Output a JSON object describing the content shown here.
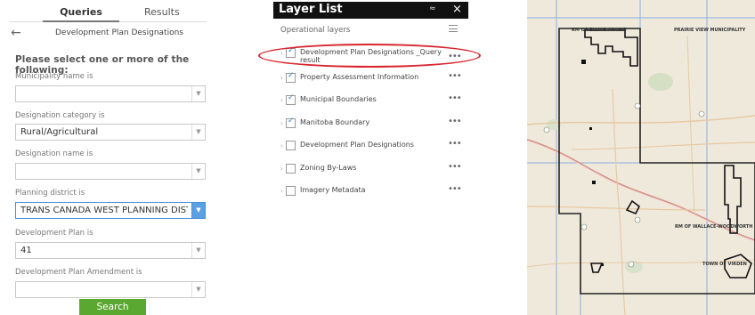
{
  "query_panel": {
    "tabs": [
      "Queries",
      "Results"
    ],
    "title": "Development Plan Designations",
    "prompt": "Please select one or more of the following:",
    "fields": [
      {
        "label": "Municipality name is",
        "value": ""
      },
      {
        "label": "Designation category is",
        "value": "Rural/Agricultural"
      },
      {
        "label": "Designation name is",
        "value": ""
      },
      {
        "label": "Planning district is",
        "value": "TRANS CANADA WEST PLANNING DISTF"
      },
      {
        "label": "Development Plan is",
        "value": "41"
      },
      {
        "label": "Development Plan Amendment is",
        "value": ""
      }
    ],
    "search_label": "Search"
  },
  "layer_list": {
    "title": "Layer List",
    "collapse_glyph": "≈",
    "close_glyph": "×",
    "operational_label": "Operational layers",
    "layers": [
      {
        "name": "Development Plan Designations _Query result",
        "checked": true
      },
      {
        "name": "Property Assessment Information",
        "checked": true
      },
      {
        "name": "Municipal Boundaries",
        "checked": true
      },
      {
        "name": "Manitoba Boundary",
        "checked": true
      },
      {
        "name": "Development Plan Designations",
        "checked": false
      },
      {
        "name": "Zoning By-Laws",
        "checked": false
      },
      {
        "name": "Imagery Metadata",
        "checked": false
      }
    ],
    "more_glyph": "•••"
  },
  "map": {
    "labels": {
      "ellice": "RM OF ELLICE-ARCHIE",
      "prairie": "PRAIRIE VIEW MUNICIPALITY",
      "wallace": "RM OF WALLACE-WOODWORTH",
      "virden": "TOWN OF VIRDEN"
    }
  },
  "colors": {
    "accent": "#5aa82f",
    "highlight": "#d8262e",
    "checkbox": "#3a86c8"
  }
}
